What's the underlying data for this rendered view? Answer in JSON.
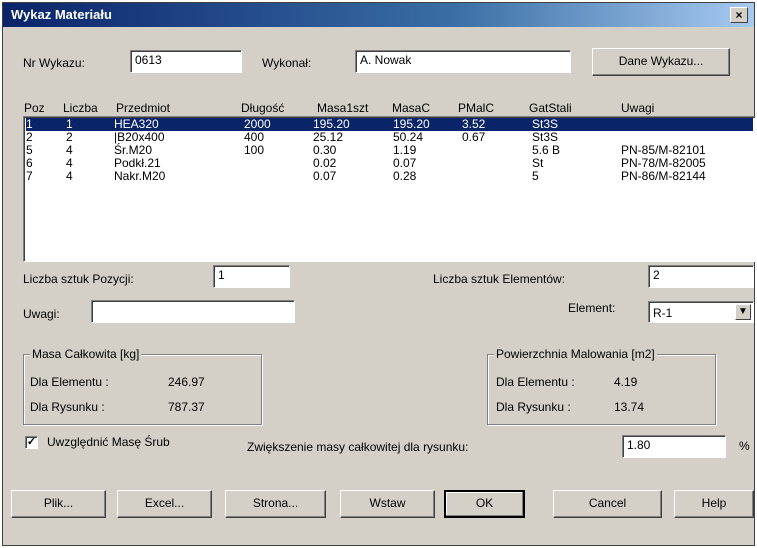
{
  "window": {
    "title": "Wykaz Materiału",
    "close_label": "×"
  },
  "header": {
    "nr_label": "Nr Wykazu:",
    "nr_value": "0613",
    "wykonal_label": "Wykonał:",
    "wykonal_value": "A. Nowak",
    "dane_button": "Dane Wykazu..."
  },
  "table": {
    "columns": [
      "Poz",
      "Liczba",
      "Przedmiot",
      "Długość",
      "Masa1szt",
      "MasaC",
      "PMalC",
      "GatStali",
      "Uwagi"
    ],
    "rows": [
      {
        "poz": "1",
        "liczba": "1",
        "przedmiot": "HEA320",
        "dlugosc": "2000",
        "masa1szt": "195.20",
        "masac": "195.20",
        "pmalc": "3.52",
        "gatstali": "St3S",
        "uwagi": ""
      },
      {
        "poz": "2",
        "liczba": "2",
        "przedmiot": "|B20x400",
        "dlugosc": "400",
        "masa1szt": "25.12",
        "masac": "50.24",
        "pmalc": "0.67",
        "gatstali": "St3S",
        "uwagi": ""
      },
      {
        "poz": "5",
        "liczba": "4",
        "przedmiot": "Śr.M20",
        "dlugosc": "100",
        "masa1szt": "0.30",
        "masac": "1.19",
        "pmalc": "",
        "gatstali": "5.6 B",
        "uwagi": "PN-85/M-82101"
      },
      {
        "poz": "6",
        "liczba": "4",
        "przedmiot": "Podkł.21",
        "dlugosc": "",
        "masa1szt": "0.02",
        "masac": "0.07",
        "pmalc": "",
        "gatstali": "St",
        "uwagi": "PN-78/M-82005"
      },
      {
        "poz": "7",
        "liczba": "4",
        "przedmiot": "Nakr.M20",
        "dlugosc": "",
        "masa1szt": "0.07",
        "masac": "0.28",
        "pmalc": "",
        "gatstali": "5",
        "uwagi": "PN-86/M-82144"
      }
    ]
  },
  "fields": {
    "liczba_poz_label": "Liczba sztuk Pozycji:",
    "liczba_poz_value": "1",
    "liczba_el_label": "Liczba sztuk Elementów:",
    "liczba_el_value": "2",
    "uwagi_label": "Uwagi:",
    "uwagi_value": "",
    "element_label": "Element:",
    "element_value": "R-1"
  },
  "masa_group": {
    "legend": "Masa Całkowita [kg]",
    "dla_elementu_label": "Dla Elementu :",
    "dla_elementu_value": "246.97",
    "dla_rysunku_label": "Dla Rysunku  :",
    "dla_rysunku_value": "787.37"
  },
  "pow_group": {
    "legend": "Powierzchnia Malowania [m2]",
    "dla_elementu_label": "Dla Elementu :",
    "dla_elementu_value": "4.19",
    "dla_rysunku_label": "Dla Rysunku  :",
    "dla_rysunku_value": "13.74"
  },
  "options": {
    "checkbox_label": "Uwzględnić Masę Śrub",
    "checkbox_checked": "✓",
    "zwiekszenie_label": "Zwiększenie masy całkowitej dla rysunku:",
    "zwiekszenie_value": "1.80",
    "percent": "%"
  },
  "buttons": {
    "plik": "Plik...",
    "excel": "Excel...",
    "strona": "Strona...",
    "wstaw": "Wstaw",
    "ok": "OK",
    "cancel": "Cancel",
    "help": "Help"
  },
  "colors": {
    "selection": "#0a246a",
    "face": "#d4d0c8"
  }
}
